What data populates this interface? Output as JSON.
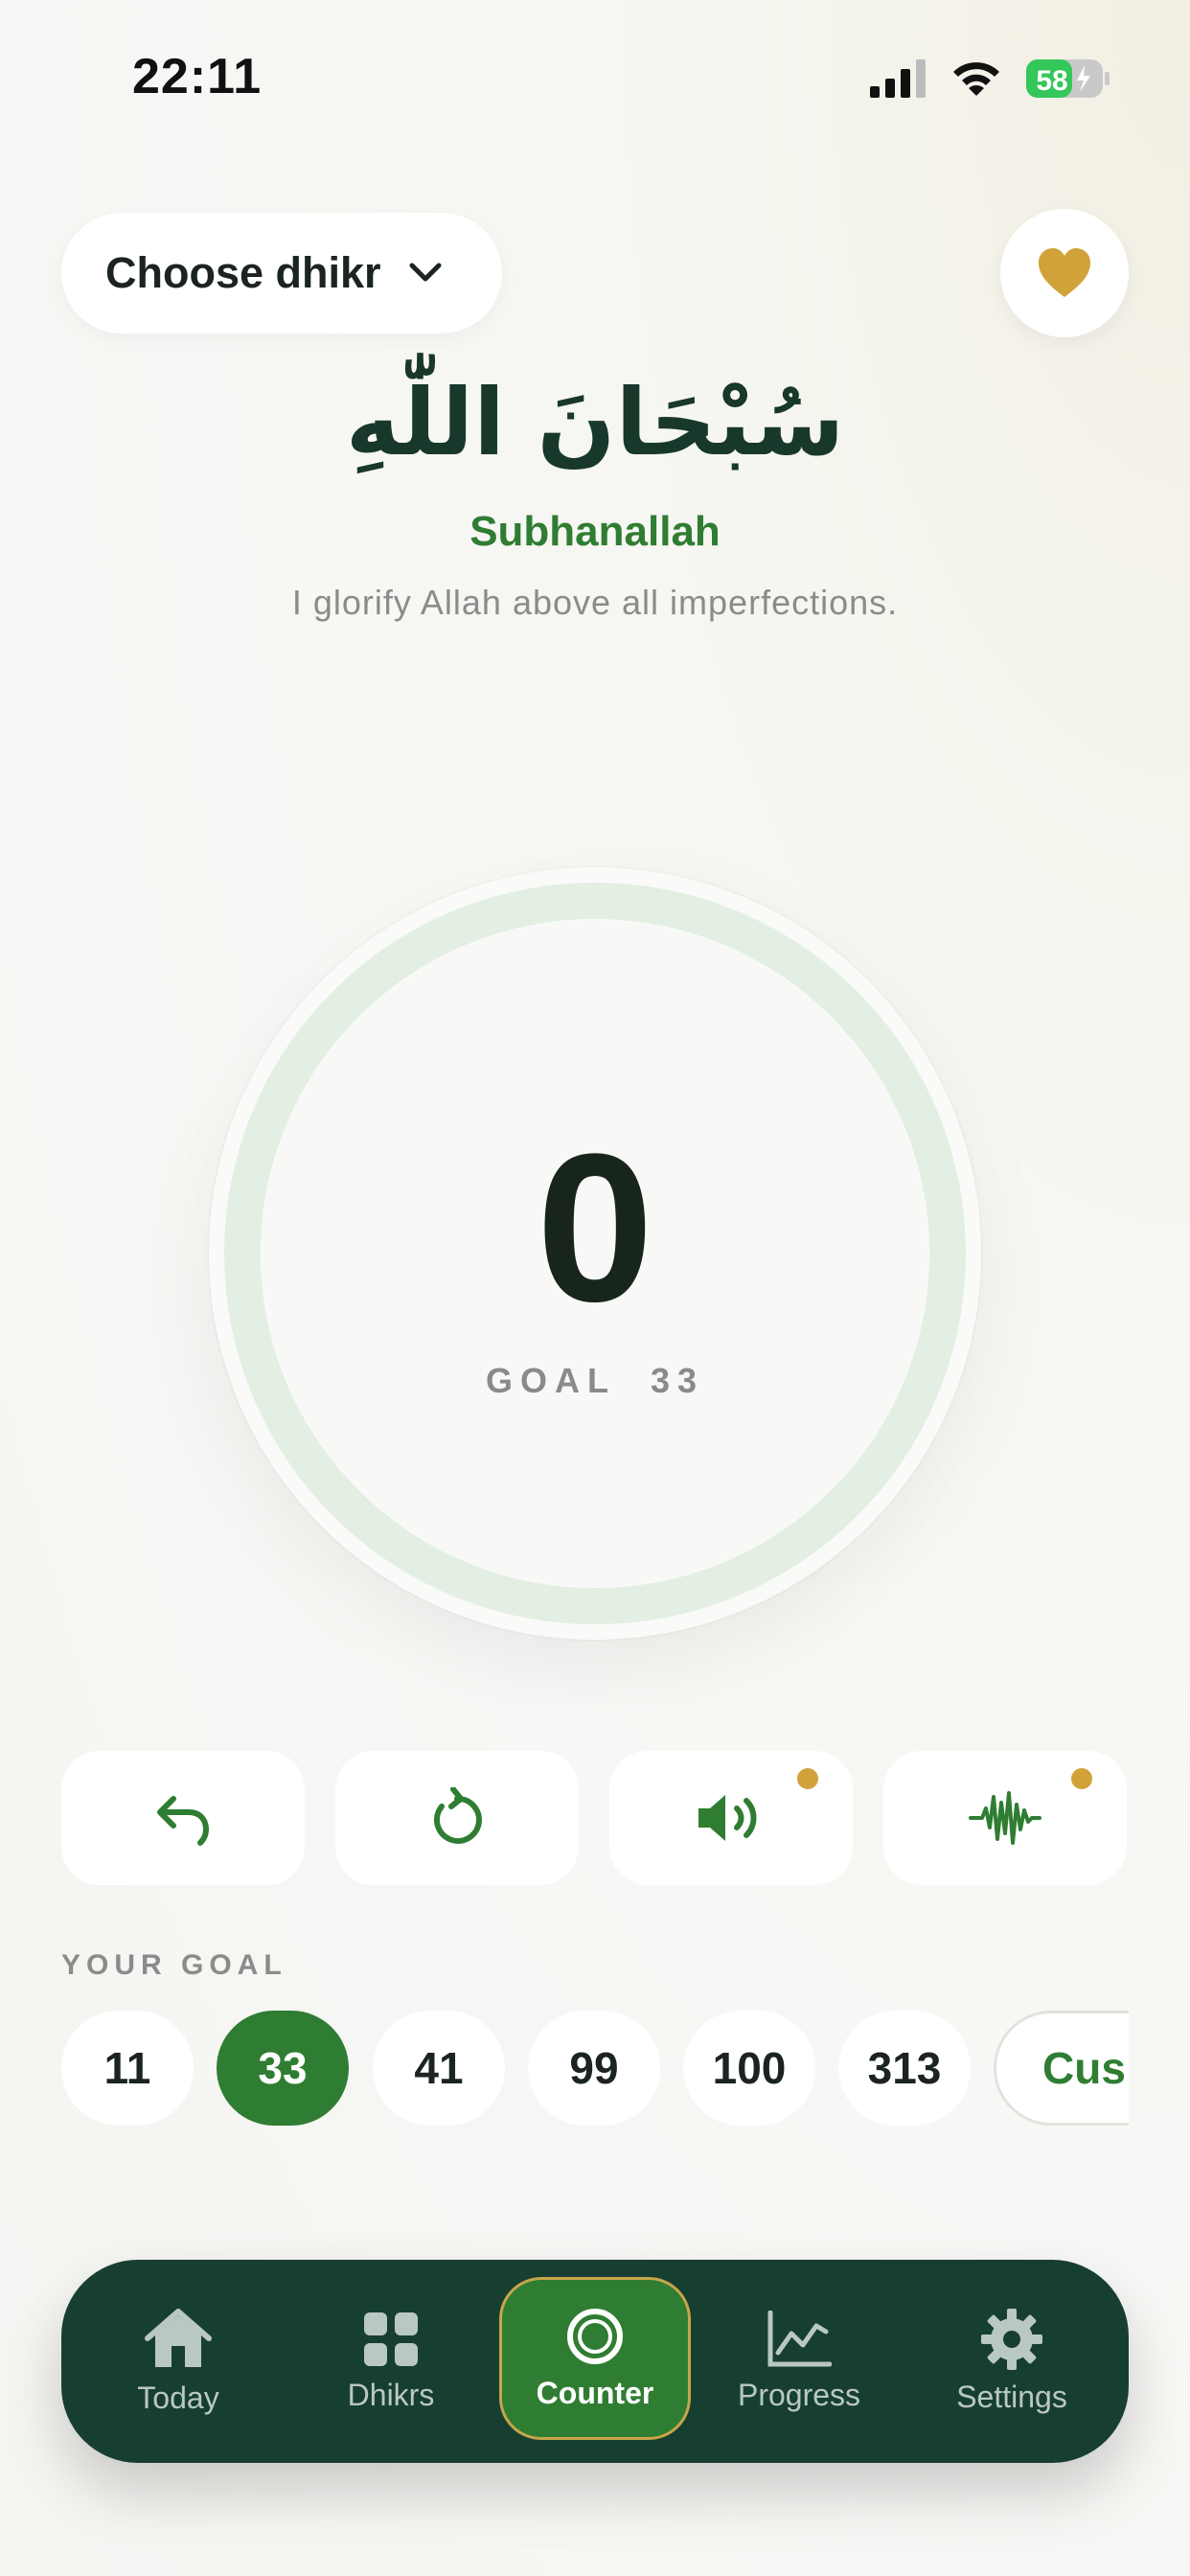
{
  "status": {
    "time": "22:11",
    "battery": "58"
  },
  "header": {
    "choose_label": "Choose dhikr"
  },
  "dhikr": {
    "arabic": "سُبْحَانَ اللّٰهِ",
    "transliteration": "Subhanallah",
    "meaning": "I glorify Allah above all imperfections."
  },
  "counter": {
    "value": "0",
    "goal_prefix": "GOAL",
    "goal_value": "33",
    "progress": 0
  },
  "controls": [
    {
      "name": "undo-icon"
    },
    {
      "name": "reset-icon"
    },
    {
      "name": "sound-icon",
      "badge": true
    },
    {
      "name": "haptic-icon",
      "badge": true
    }
  ],
  "goal": {
    "title": "YOUR GOAL",
    "options": [
      "11",
      "33",
      "41",
      "99",
      "100",
      "313"
    ],
    "selected": "33",
    "custom_label": "Cus"
  },
  "tabs": [
    {
      "label": "Today",
      "icon": "home-icon"
    },
    {
      "label": "Dhikrs",
      "icon": "grid-icon"
    },
    {
      "label": "Counter",
      "icon": "counter-icon",
      "active": true
    },
    {
      "label": "Progress",
      "icon": "chart-icon"
    },
    {
      "label": "Settings",
      "icon": "gear-icon"
    }
  ],
  "colors": {
    "accent": "#2f7d32",
    "gold": "#d1a23a",
    "tabbar": "#173f31"
  }
}
